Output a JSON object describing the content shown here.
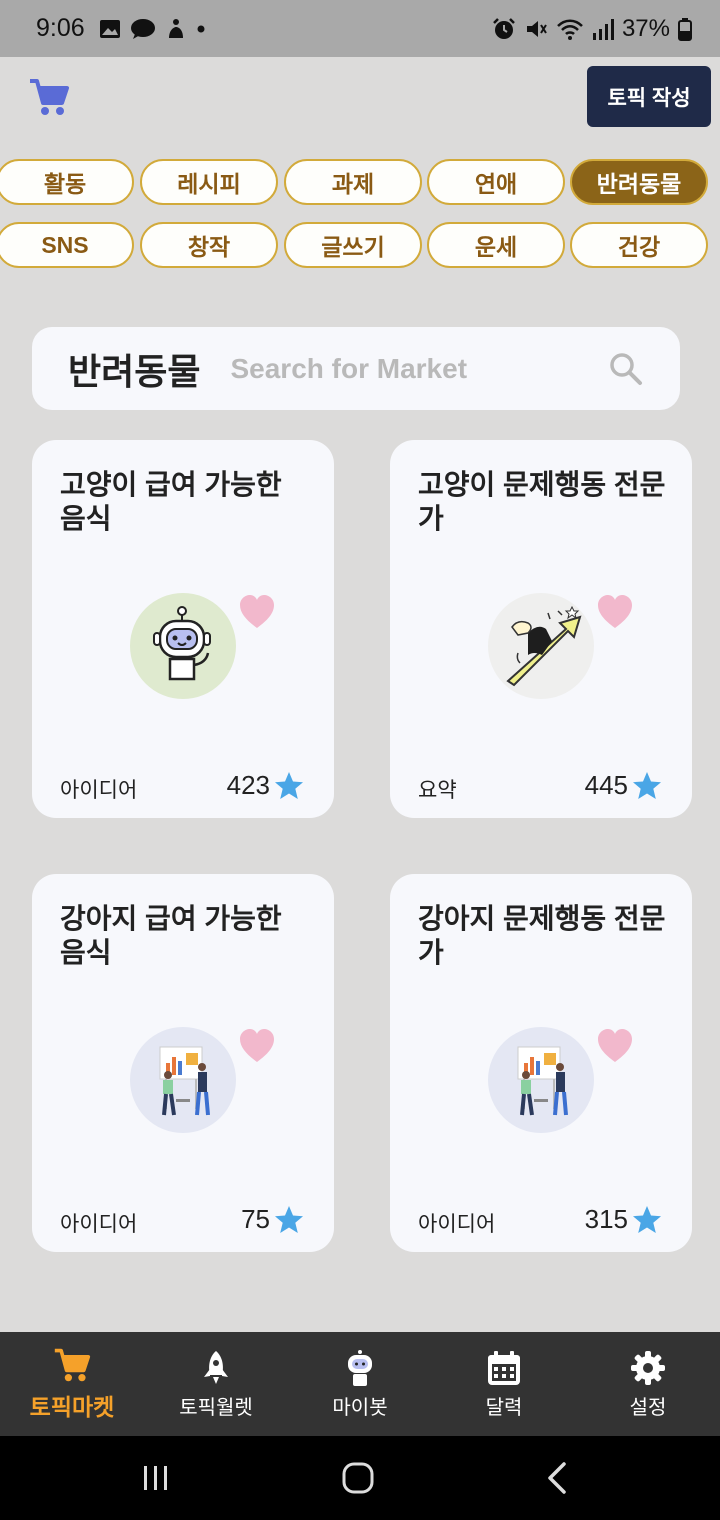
{
  "status_bar": {
    "time": "9:06",
    "battery": "37%"
  },
  "header": {
    "cart_icon": "shopping-cart-icon",
    "create_button": "토픽 작성"
  },
  "categories": {
    "row1": [
      {
        "label": "활동",
        "active": false
      },
      {
        "label": "레시피",
        "active": false
      },
      {
        "label": "과제",
        "active": false
      },
      {
        "label": "연애",
        "active": false
      },
      {
        "label": "반려동물",
        "active": true
      }
    ],
    "row2": [
      {
        "label": "SNS",
        "active": false
      },
      {
        "label": "창작",
        "active": false
      },
      {
        "label": "글쓰기",
        "active": false
      },
      {
        "label": "운세",
        "active": false
      },
      {
        "label": "건강",
        "active": false
      }
    ]
  },
  "search": {
    "title": "반려동물",
    "placeholder": "Search for Market"
  },
  "cards": [
    {
      "title": "고양이 급여 가능한 음식",
      "category": "아이디어",
      "rating": "423",
      "image": "robot"
    },
    {
      "title": "고양이 문제행동 전문가",
      "category": "요약",
      "rating": "445",
      "image": "growth-arrow"
    },
    {
      "title": "강아지 급여 가능한 음식",
      "category": "아이디어",
      "rating": "75",
      "image": "business-presentation"
    },
    {
      "title": "강아지 문제행동 전문가",
      "category": "아이디어",
      "rating": "315",
      "image": "business-presentation"
    }
  ],
  "bottom_nav": [
    {
      "label": "토픽마켓",
      "icon": "shopping-cart-icon",
      "active": true
    },
    {
      "label": "토픽월렛",
      "icon": "rocket-icon",
      "active": false
    },
    {
      "label": "마이봇",
      "icon": "robot-icon",
      "active": false
    },
    {
      "label": "달력",
      "icon": "calendar-icon",
      "active": false
    },
    {
      "label": "설정",
      "icon": "gear-icon",
      "active": false
    }
  ],
  "colors": {
    "accent": "#8b6418",
    "chip_border": "#d2aa3a",
    "nav_active": "#f5a12a",
    "heart": "#f2b8cc",
    "star": "#4aa6e6",
    "button_dark": "#1f2a48"
  }
}
